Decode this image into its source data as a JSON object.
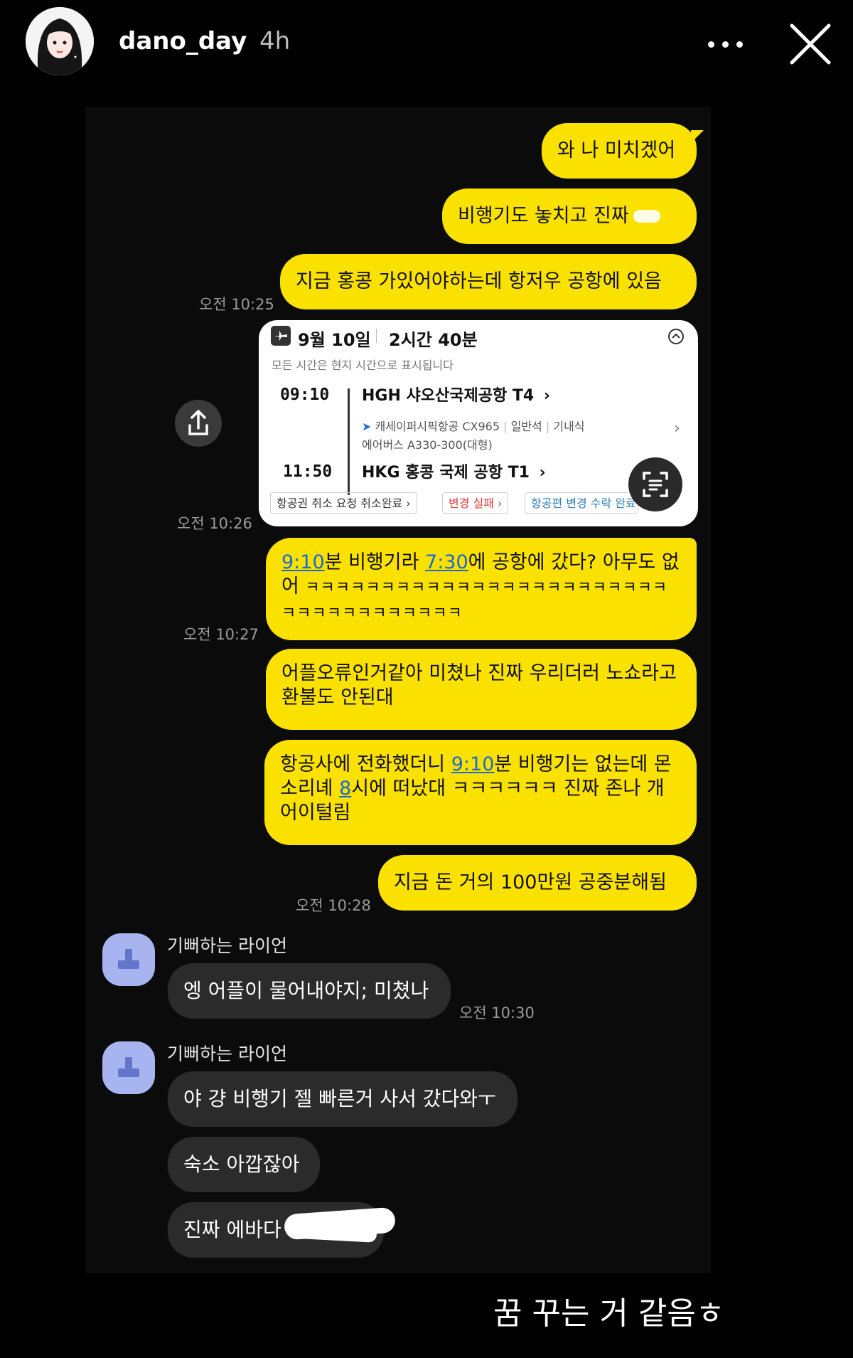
{
  "header": {
    "username": "dano_day",
    "time_ago": "4h"
  },
  "chat": {
    "my_messages": [
      {
        "text": "와 나 미치겠어"
      },
      {
        "text": "비행기도 놓치고 진짜"
      },
      {
        "text": "지금 홍콩 가있어야하는데 항저우 공항에 있음"
      },
      {
        "text_parts": [
          "9:10",
          "분 비행기라 ",
          "7:30",
          "에 공항에 갔다? 아무도 없어 ",
          "ㅋㅋㅋㅋㅋㅋㅋㅋㅋㅋㅋㅋㅋㅋㅋㅋㅋㅋㅋㅋㅋㅋㅋㅋㅋㅋㅋㅋㅋㅋㅋㅋㅋㅋㅋㅋ"
        ]
      },
      {
        "text": "어플오류인거같아 미쳤나 진짜 우리더러 노쇼라고 환불도 안된대"
      },
      {
        "text_parts": [
          "항공사에 전화했더니 ",
          "9:10",
          "분 비행기는 없는데 몬소리녜 ",
          "8",
          "시에 떠났대 ㅋㅋㅋㅋㅋㅋ 진짜 존나 개 어이털림"
        ]
      },
      {
        "text": "지금 돈 거의 100만원 공중분해됨"
      }
    ],
    "timestamps": [
      "오전 10:25",
      "오전 10:26",
      "오전 10:27",
      "오전 10:28",
      "오전 10:30"
    ],
    "friend": {
      "name": "기뻐하는 라이언",
      "messages": [
        "엥 어플이 물어내야지; 미쳤나",
        "야 걍 비행기 젤 빠른거 사서 갔다와ㅜ",
        "숙소 아깝잖아",
        "진짜 에바다"
      ]
    },
    "flight_card": {
      "date": "9월 10일",
      "duration": "2시간 40분",
      "note": "모든 시간은 현지 시간으로 표시됩니다",
      "dep_time": "09:10",
      "dep_airport": "HGH  샤오산국제공항 T4",
      "airline": "캐세이퍼시픽항공 CX965",
      "cabin": "일반석",
      "meal": "기내식",
      "aircraft": "에어버스 A330-300(대형)",
      "arr_time": "11:50",
      "arr_airport": "HKG  홍콩 국제 공항 T1",
      "tags": [
        "항공권 취소 요청 취소완료",
        "변경 실패",
        "항공편 변경 수락 완료"
      ],
      "tag_colors": [
        "#333333",
        "#e23b3b",
        "#2f7fb8"
      ]
    }
  },
  "caption": "꿈 꾸는 거 같음ㅎ",
  "colors": {
    "my_bubble": "#FAE100",
    "friend_bubble": "#2b2b2b",
    "background": "#000000",
    "link": "#1a6ad6"
  }
}
